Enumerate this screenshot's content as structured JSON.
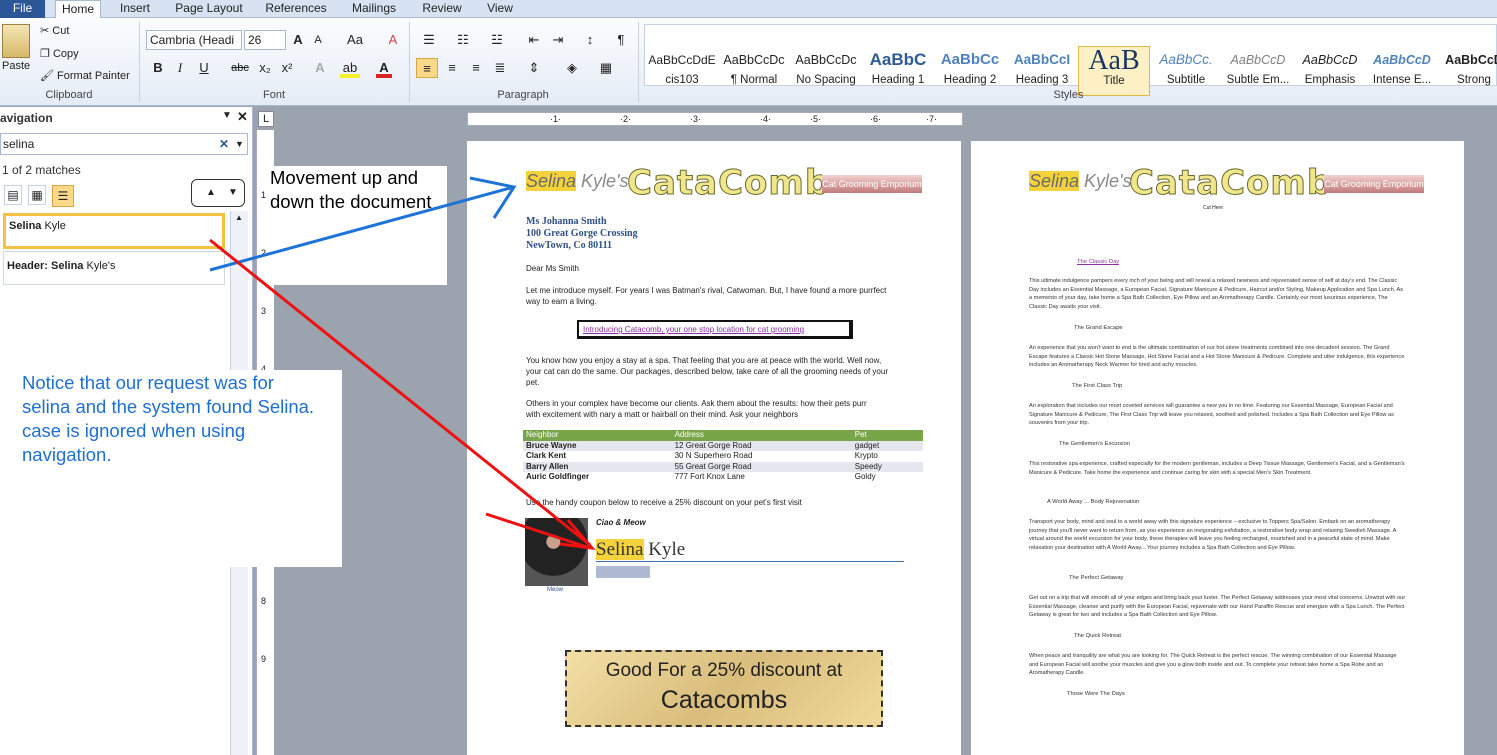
{
  "ribbon_tabs": [
    "File",
    "Home",
    "Insert",
    "Page Layout",
    "References",
    "Mailings",
    "Review",
    "View"
  ],
  "clipboard": {
    "paste": "Paste",
    "cut": "Cut",
    "copy": "Copy",
    "format_painter": "Format Painter",
    "group": "Clipboard"
  },
  "font": {
    "family": "Cambria (Headi",
    "size": "26",
    "group": "Font",
    "bold": "B",
    "italic": "I",
    "underline": "U",
    "strike": "abc",
    "sub": "x₂",
    "sup": "x²",
    "grow": "A",
    "shrink": "A",
    "change_case": "Aa",
    "clear": "A"
  },
  "paragraph": {
    "group": "Paragraph",
    "show_marks": "¶"
  },
  "styles": {
    "group": "Styles",
    "items": [
      {
        "preview": "AaBbCcDdE",
        "name": "cis103"
      },
      {
        "preview": "AaBbCcDc",
        "name": "¶ Normal"
      },
      {
        "preview": "AaBbCcDc",
        "name": "No Spacing"
      },
      {
        "preview": "AaBbC",
        "name": "Heading 1"
      },
      {
        "preview": "AaBbCc",
        "name": "Heading 2"
      },
      {
        "preview": "AaBbCcI",
        "name": "Heading 3"
      },
      {
        "preview": "AaB",
        "name": "Title"
      },
      {
        "preview": "AaBbCc.",
        "name": "Subtitle"
      },
      {
        "preview": "AaBbCcD",
        "name": "Subtle Em..."
      },
      {
        "preview": "AaBbCcD",
        "name": "Emphasis"
      },
      {
        "preview": "AaBbCcD",
        "name": "Intense E..."
      },
      {
        "preview": "AaBbCcD",
        "name": "Strong"
      }
    ]
  },
  "navigation": {
    "title": "avigation",
    "search_value": "selina",
    "match_count": "1 of 2 matches",
    "results": [
      {
        "bold": "Selina",
        "rest": " Kyle"
      },
      {
        "bold": "Header: Selina",
        "rest": " Kyle's"
      }
    ]
  },
  "annotations": {
    "movement": "Movement up and down the document",
    "notice": "Notice that our request was for selina and the system found Selina. case is ignored when using navigation."
  },
  "page1": {
    "header_hl": "Selina",
    "header_rest": " Kyle's",
    "logo": "CataComb",
    "tagline": "Cat Grooming Emporium",
    "address": [
      "Ms Johanna  Smith",
      "100 Great Gorge Crossing",
      "NewTown, Co 80111"
    ],
    "salutation": "Dear Ms Smith",
    "intro": "Let me introduce myself. For years I was Batman's rival, Catwoman. But, I have found a more purrfect way to earn a living.",
    "banner": "Introducing Catacomb, your one stop location for cat grooming",
    "para2": "You know how you enjoy a stay at a spa. That feeling that you are at peace with the world. Well now, your cat can do the same. Our packages, described below, take care of all the grooming needs of your pet.",
    "para3": "Others in your complex have become our clients. Ask them about the results: how their pets purr with excitement with nary a matt or hairball on their mind. Ask your neighbors",
    "table_headers": [
      "Neighbor",
      "Address",
      "Pet"
    ],
    "table_rows": [
      [
        "Bruce Wayne",
        "12 Great Gorge Road",
        "gadget"
      ],
      [
        "Clark Kent",
        "30 N Superhero Road",
        "Krypto"
      ],
      [
        "Barry Allen",
        "55 Great Gorge Road",
        "Speedy"
      ],
      [
        "Auric Goldfinger",
        "777 Fort Knox Lane",
        "Goldy"
      ]
    ],
    "coupon_line": "Use the handy coupon below to receive a 25% discount on your pet's first visit",
    "closing": "Ciao & Meow",
    "sig_hl": "Selina",
    "sig_rest": " Kyle",
    "photo_caption": "Meow",
    "coupon1": "Good For a 25% discount at",
    "coupon2": "Catacombs"
  },
  "page2": {
    "header_hl": "Selina",
    "header_rest": " Kyle's",
    "logo": "CataComb",
    "tagline": "Cat Grooming Emporium",
    "cut_here": "Cut Here",
    "classic_title": "The Classic Day",
    "classic": "This ultimate indulgence pampers every inch of your being and will reveal a relaxed newness and rejuvenated sense of self at day's end. The Classic Day includes an Essential Massage, a European Facial, Signature Manicure & Pedicure, Haircut and/or Styling, Makeup Application and Spa Lunch. As a memento of your day, take home a Spa Bath Collection, Eye Pillow and an Aromatherapy Candle. Certainly our most luxurious experience, The Classic Day awaits your visit.",
    "escape_title": "The Grand Escape",
    "escape": "An experience that you won't want to end is the ultimate combination of our hot stone treatments combined into one decadent session. The Grand Escape features a Classic Hot Stone Massage, Hot Stone Facial and a Hot Stone Manicure & Pedicure. Complete and utter indulgence, this experience includes an Aromatherapy Neck Warmer for tired and achy muscles.",
    "first_title": "The First Class Trip",
    "first": "An exploration that includes our most coveted services will guarantee a new you in no time. Featuring our Essential Massage, European Facial and Signature Manicure & Pedicure, The First Class Trip will leave you relaxed, soothed and polished. Includes a Spa Bath Collection and Eye Pillow as souvenirs from your trip.",
    "gent_title": "The Gentlemen's Excursion",
    "gent": "This restorative spa experience, crafted especially for the modern gentleman, includes a Deep Tissue Massage, Gentlemen's Facial, and a Gentleman's Manicure & Pedicure. Take home the experience and continue caring for skin with a special Men's Skin Treatment.",
    "world_title": "A World Away ... Body Rejuvenation",
    "world": "Transport your body, mind and soul to a world away with this signature experience – exclusive to Toppers Spa/Salon. Embark on an aromatherapy journey that you'll never want to return from, as you experience an invigorating exfoliation, a restorative body wrap and relaxing Swedish Massage. A virtual around the world excursion for your body, these therapies will leave you feeling recharged, nourished and in a peaceful state of mind. Make relaxation your destination with A World Away... Your journey includes a Spa Bath Collection and Eye Pillow.",
    "getaway_title": "The Perfect Getaway",
    "getaway": "Get out on a trip that will smooth all of your edges and bring back your luster. The Perfect Getaway addresses your most vital concerns. Unwind with our Essential Massage, cleanse and purify with the European Facial, rejuvenate with our Hand Paraffin Rescue and energize with a Spa Lunch. The Perfect Getaway is great for two and includes a Spa Bath Collection and Eye Pillow.",
    "quick_title": "The Quick Retreat",
    "quick": "When peace and tranquility are what you are looking for, The Quick Retreat is the perfect rescue. The winning combination of our Essential Massage and European Facial will soothe your muscles and give you a glow both inside and out. To complete your retreat take home a Spa Robe and an Aromatherapy Candle.",
    "days_title": "Those Were The Days"
  }
}
